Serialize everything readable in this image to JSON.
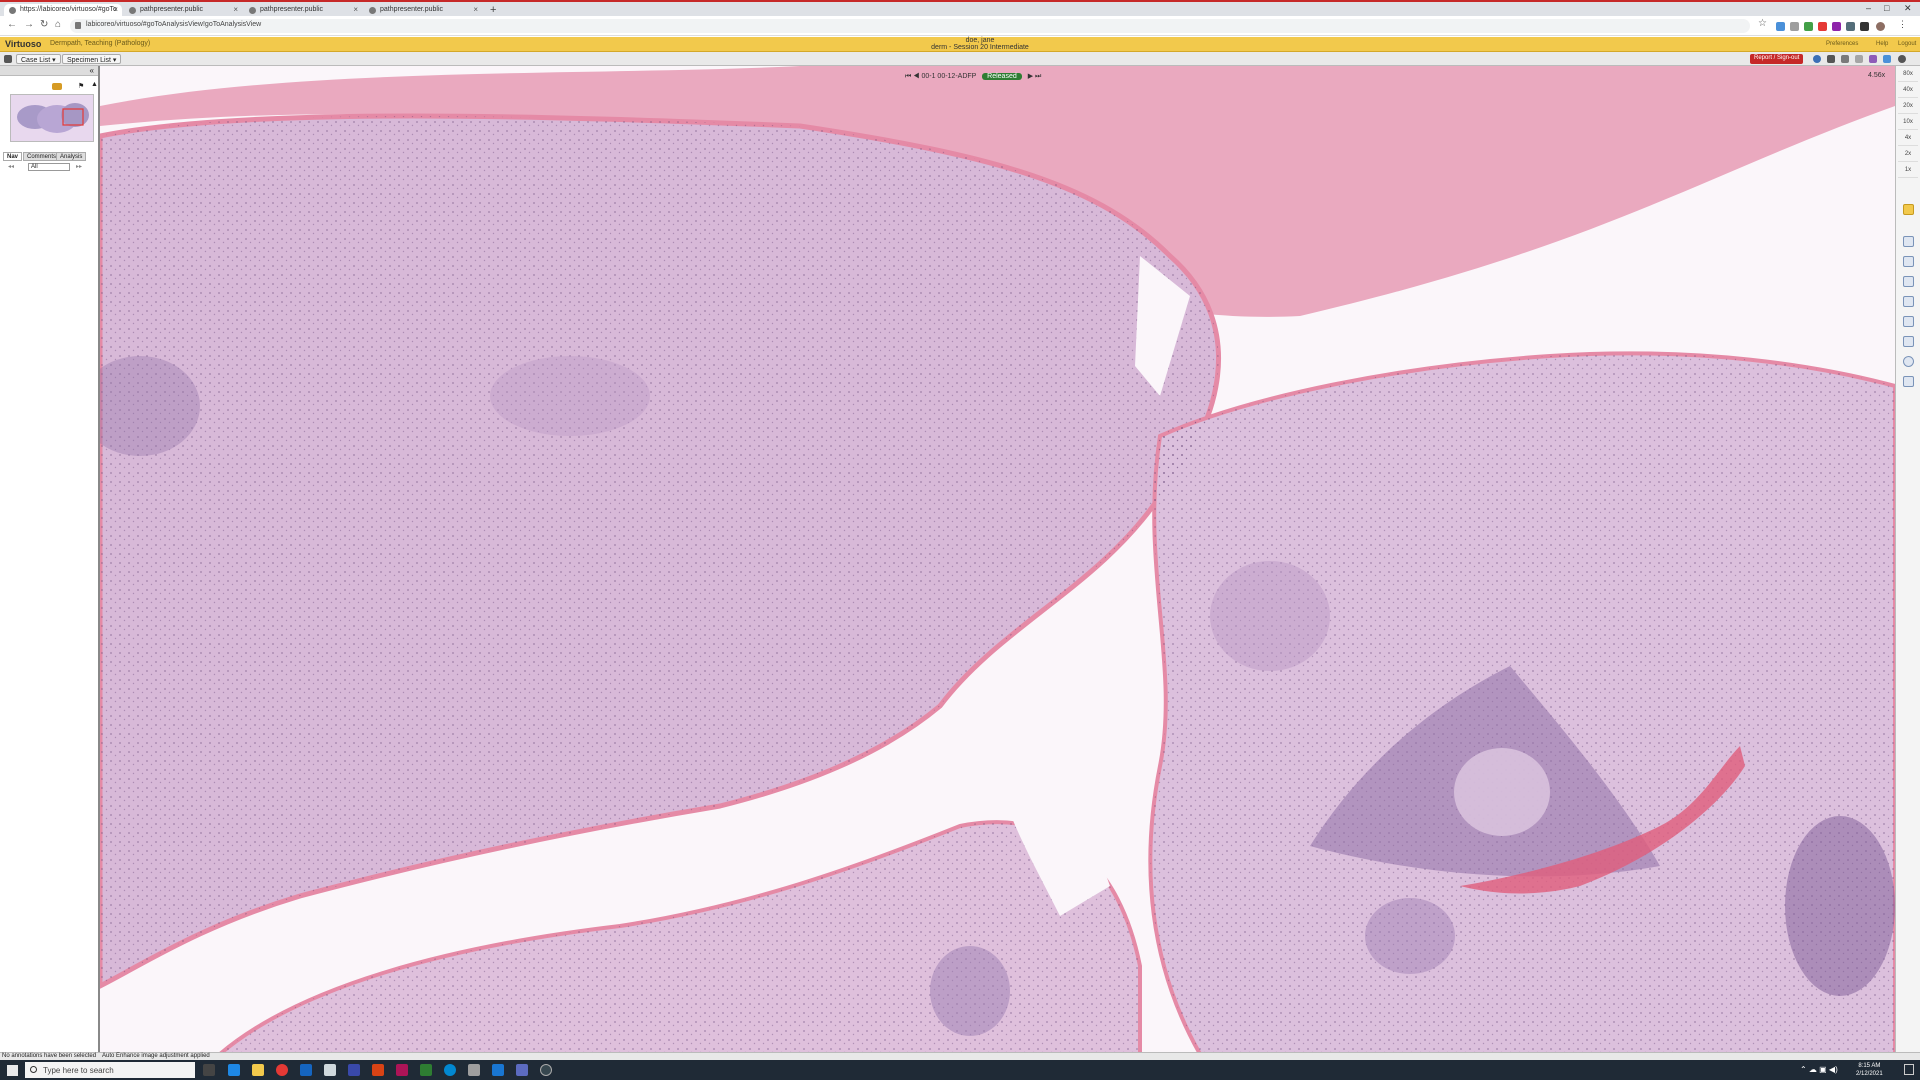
{
  "browser": {
    "tabs": [
      {
        "title": "https://labicoreo/virtuoso/#goTo",
        "active": true
      },
      {
        "title": "pathpresenter.public",
        "active": false
      },
      {
        "title": "pathpresenter.public",
        "active": false
      },
      {
        "title": "pathpresenter.public",
        "active": false
      }
    ],
    "new_tab": "+",
    "url": "labicoreo/virtuoso/#goToAnalysisView!goToAnalysisView"
  },
  "app": {
    "name": "Virtuoso",
    "course": "Dermpath, Teaching (Pathology)",
    "user_name": "doe, jane",
    "session": "derm - Session 20 Intermediate",
    "header_links": [
      "Preferences",
      "Help",
      "Logout"
    ]
  },
  "toolbar": {
    "case_list": "Case List",
    "specimen_list": "Specimen List",
    "report_button": "Report / Sign-out"
  },
  "sidebar": {
    "tabs": [
      "Nav",
      "Comments",
      "Analysis"
    ],
    "filter_value": "All"
  },
  "viewer": {
    "slide_id": "00-1 00-12-ADFP",
    "status": "Released",
    "zoom_readout": "4.56x",
    "magnifications": [
      "80x",
      "40x",
      "20x",
      "10x",
      "4x",
      "2x",
      "1x"
    ]
  },
  "status": {
    "left": "No annotations have been selected",
    "message": "Auto Enhance image adjustment applied"
  },
  "taskbar": {
    "search_placeholder": "Type here to search",
    "time": "8:15 AM",
    "date": "2/12/2021"
  },
  "colors": {
    "header_yellow": "#f2c94c",
    "report_red": "#c62828",
    "released_green": "#2e7d32",
    "stain_pink": "#e8a6bd",
    "stain_lilac": "#d9bad9",
    "nuclei_purple": "#5b3a6e"
  }
}
